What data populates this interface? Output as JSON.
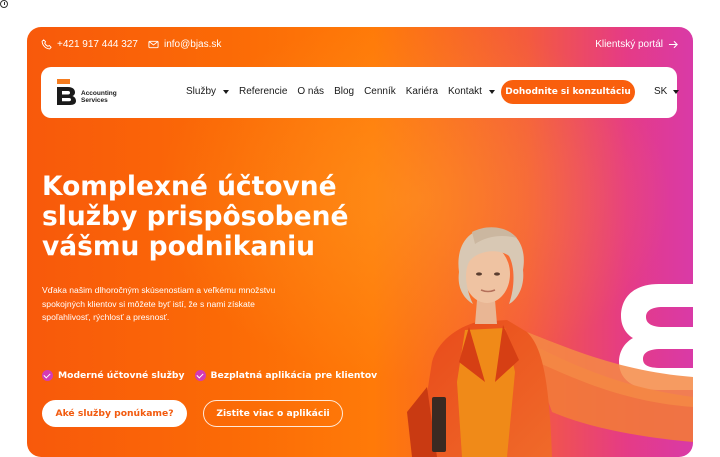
{
  "topbar": {
    "phone": "+421 917 444 327",
    "email": "info@bjas.sk",
    "client_portal": "Klientský portál",
    "phone_icon": "phone-icon",
    "email_icon": "mail-icon",
    "portal_icon": "arrow-right-icon"
  },
  "brand": {
    "name_line1": "Accounting",
    "name_line2": "Services"
  },
  "nav": {
    "items": [
      {
        "label": "Služby",
        "dropdown": true
      },
      {
        "label": "Referencie",
        "dropdown": false
      },
      {
        "label": "O nás",
        "dropdown": false
      },
      {
        "label": "Blog",
        "dropdown": false
      },
      {
        "label": "Cenník",
        "dropdown": false
      },
      {
        "label": "Kariéra",
        "dropdown": false
      },
      {
        "label": "Kontakt",
        "dropdown": true
      }
    ],
    "cta": "Dohodnite si konzultáciu",
    "language": "SK"
  },
  "hero": {
    "headline_1": "Komplexné účtovné",
    "headline_2": "služby prispôsobené",
    "headline_3": "vášmu podnikaniu",
    "description_1": "Vďaka našim dlhoročným skúsenostiam a veľkému množstvu",
    "description_2": "spokojných klientov si môžete byť istí, že s nami získate",
    "description_3": "spoľahlivosť, rýchlosť a presnosť.",
    "features": [
      "Moderné účtovné služby",
      "Bezplatná aplikácia pre klientov"
    ],
    "primary_button": "Aké služby ponúkame?",
    "secondary_button": "Zistite viac o aplikácii"
  },
  "colors": {
    "accent": "#f95f0d",
    "gradient_start": "#f8590b",
    "gradient_end": "#d93aa7",
    "check": "#d43bb5"
  }
}
